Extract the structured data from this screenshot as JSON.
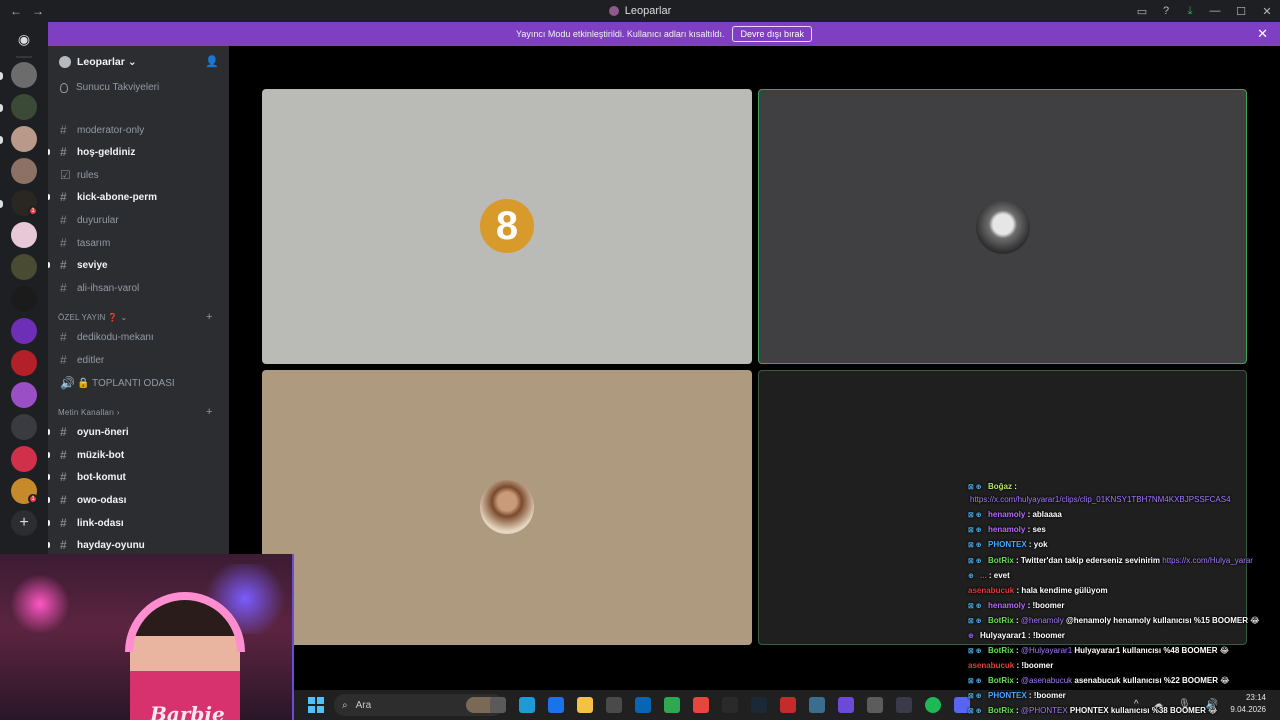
{
  "window": {
    "title": "Leoparlar",
    "back": "←",
    "forward": "→",
    "inbox_icon": "inbox-icon",
    "help": "?",
    "download": "⤓",
    "minimize": "—",
    "maximize": "☐",
    "close": "✕"
  },
  "banner": {
    "text": "Yayıncı Modu etkinleştirildi. Kullanıcı adları kısaltıldı.",
    "button": "Devre dışı bırak",
    "close": "✕"
  },
  "guild": {
    "name": "Leoparlar",
    "chevron": "⌄",
    "boost_label": "Sunucu Takviyeleri"
  },
  "channels": [
    {
      "name": "moderator-only",
      "unread": false,
      "icon": "#"
    },
    {
      "name": "hoş-geldiniz",
      "unread": true,
      "icon": "#"
    },
    {
      "name": "rules",
      "unread": false,
      "icon": "☑"
    },
    {
      "name": "kick-abone-perm",
      "unread": true,
      "icon": "#"
    },
    {
      "name": "duyurular",
      "unread": false,
      "icon": "#"
    },
    {
      "name": "tasarım",
      "unread": false,
      "icon": "#"
    },
    {
      "name": "seviye",
      "unread": true,
      "icon": "#"
    },
    {
      "name": "ali-ihsan-varol",
      "unread": false,
      "icon": "#"
    }
  ],
  "category_ozel": {
    "label": "ÖZEL YAYIN ❓ ⌄",
    "plus": "+",
    "channels": [
      {
        "name": "dedikodu-mekanı",
        "icon": "#"
      },
      {
        "name": "editler",
        "icon": "#"
      },
      {
        "name": "🔒 TOPLANTI ODASI",
        "icon": "🔊"
      }
    ]
  },
  "category_metin": {
    "label": "Metin Kanalları ›",
    "plus": "+",
    "channels": [
      {
        "name": "oyun-öneri",
        "unread": true
      },
      {
        "name": "müzik-bot",
        "unread": true
      },
      {
        "name": "bot-komut",
        "unread": true
      },
      {
        "name": "owo-odası",
        "unread": true
      },
      {
        "name": "link-odası",
        "unread": true
      },
      {
        "name": "hayday-oyunu",
        "unread": true
      }
    ]
  },
  "stage": {
    "tile1_avatar_text": "8"
  },
  "webcam": {
    "shirt_text": "Barbie"
  },
  "taskbar": {
    "search_placeholder": "Ara",
    "time": "23:14",
    "date": "9.04.2026",
    "tray_icons": "^ ☁ 🎙 🔊"
  },
  "chat": [
    {
      "badges": "⊠ ⊕",
      "user": "Boğaz",
      "user_color": "#b9e66b",
      "text": ""
    },
    {
      "badges": "",
      "user": "",
      "user_color": "#a57bff",
      "text": "",
      "link": "https://x.com/hulyayarar1/clips/clip_01KNSY1TBH7NM4KXBJPSSFCAS4"
    },
    {
      "badges": "⊠ ⊕",
      "user": "henamoly",
      "user_color": "#b66bff",
      "text": "ablaaaa"
    },
    {
      "badges": "⊠ ⊕",
      "user": "henamoly",
      "user_color": "#b66bff",
      "text": "ses"
    },
    {
      "badges": "⊠ ⊕",
      "user": "PHONTEX",
      "user_color": "#4aa8ff",
      "text": "yok"
    },
    {
      "badges": "⊠ ⊕",
      "user": "BotRix",
      "user_color": "#6bdc5a",
      "text": "Twitter'dan takip ederseniz sevinirim",
      "link": "https://x.com/Hulya_yarar"
    },
    {
      "badges": "⊕",
      "user": "...",
      "user_color": "#e23c3c",
      "text": "evet"
    },
    {
      "badges": "",
      "user": "asenabucuk",
      "user_color": "#e23c3c",
      "text": "hala kendime gülüyom"
    },
    {
      "badges": "⊠ ⊕",
      "user": "henamoly",
      "user_color": "#b66bff",
      "text": "!boomer"
    },
    {
      "badges": "⊠ ⊕",
      "user": "BotRix",
      "user_color": "#6bdc5a",
      "text": "@henamoly henamoly kullanıcısı %15 BOOMER 😂",
      "mention": "@henamoly"
    },
    {
      "badges": "⊕",
      "user": "Hulyayarar1",
      "user_color": "#ffffff",
      "text": "!boomer"
    },
    {
      "badges": "⊠ ⊕",
      "user": "BotRix",
      "user_color": "#6bdc5a",
      "text": "Hulyayarar1 kullanıcısı %48 BOOMER 😂",
      "mention": "@Hulyayarar1"
    },
    {
      "badges": "",
      "user": "asenabucuk",
      "user_color": "#e23c3c",
      "text": "!boomer"
    },
    {
      "badges": "⊠ ⊕",
      "user": "BotRix",
      "user_color": "#6bdc5a",
      "text": "asenabucuk kullanıcısı %22 BOOMER 😂",
      "mention": "@asenabucuk"
    },
    {
      "badges": "⊠ ⊕",
      "user": "PHONTEX",
      "user_color": "#4aa8ff",
      "text": "!boomer"
    },
    {
      "badges": "⊠ ⊕",
      "user": "BotRix",
      "user_color": "#6bdc5a",
      "text": "PHONTEX kullanıcısı %38 BOOMER 😂",
      "mention": "@PHONTEX"
    }
  ],
  "colors": {
    "accent": "#7e3fc2",
    "speaking": "#3ba55c",
    "bg": "#1e1f22"
  }
}
